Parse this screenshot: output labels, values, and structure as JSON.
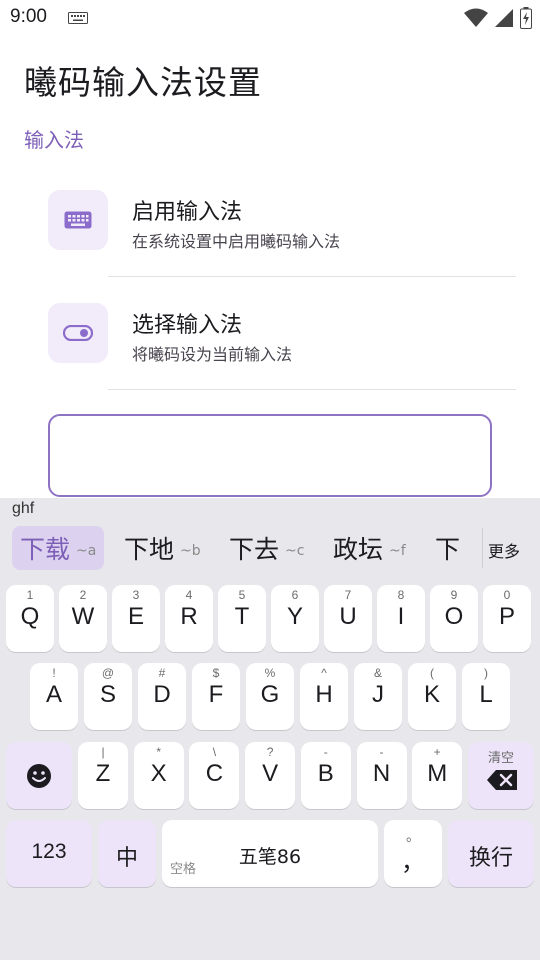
{
  "status_bar": {
    "time": "9:00"
  },
  "page": {
    "title": "曦码输入法设置",
    "section": "输入法",
    "items": [
      {
        "title": "启用输入法",
        "subtitle": "在系统设置中启用曦码输入法",
        "icon": "keyboard-icon"
      },
      {
        "title": "选择输入法",
        "subtitle": "将曦码设为当前输入法",
        "icon": "toggle-icon"
      }
    ]
  },
  "keyboard": {
    "composing": "ghf",
    "candidates": [
      {
        "word": "下载",
        "code": "~a"
      },
      {
        "word": "下地",
        "code": "~b"
      },
      {
        "word": "下去",
        "code": "~c"
      },
      {
        "word": "政坛",
        "code": "~f"
      },
      {
        "word": "下",
        "code": ""
      }
    ],
    "more": "更多",
    "row1": [
      {
        "k": "Q",
        "h": "1"
      },
      {
        "k": "W",
        "h": "2"
      },
      {
        "k": "E",
        "h": "3"
      },
      {
        "k": "R",
        "h": "4"
      },
      {
        "k": "T",
        "h": "5"
      },
      {
        "k": "Y",
        "h": "6"
      },
      {
        "k": "U",
        "h": "7"
      },
      {
        "k": "I",
        "h": "8"
      },
      {
        "k": "O",
        "h": "9"
      },
      {
        "k": "P",
        "h": "0"
      }
    ],
    "row2": [
      {
        "k": "A",
        "h": "!"
      },
      {
        "k": "S",
        "h": "@"
      },
      {
        "k": "D",
        "h": "#"
      },
      {
        "k": "F",
        "h": "$"
      },
      {
        "k": "G",
        "h": "%"
      },
      {
        "k": "H",
        "h": "^"
      },
      {
        "k": "J",
        "h": "&"
      },
      {
        "k": "K",
        "h": "("
      },
      {
        "k": "L",
        "h": ")"
      }
    ],
    "row3": [
      {
        "k": "Z",
        "h": "|"
      },
      {
        "k": "X",
        "h": "*"
      },
      {
        "k": "C",
        "h": "\\"
      },
      {
        "k": "V",
        "h": "?"
      },
      {
        "k": "B",
        "h": "-"
      },
      {
        "k": "N",
        "h": "-"
      },
      {
        "k": "M",
        "h": "+"
      }
    ],
    "clear_label": "清空",
    "num_key": "123",
    "lang_key": "中",
    "space_label": "五笔86",
    "space_hint": "空格",
    "punct_key": "，",
    "punct_hint": "。",
    "enter_key": "换行"
  },
  "colors": {
    "accent": "#7e5fb8",
    "icon_bg": "#f1ebfa",
    "func_key": "#ede4f9",
    "keyboard_bg": "#e8e8ec"
  }
}
